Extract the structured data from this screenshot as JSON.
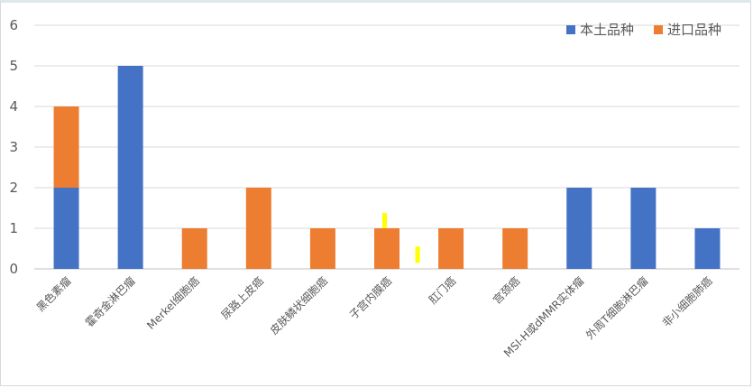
{
  "chart_data": {
    "type": "bar",
    "stacked": true,
    "categories": [
      "黑色素瘤",
      "霍奇金淋巴瘤",
      "Merkel细胞癌",
      "尿路上皮癌",
      "皮肤鳞状细胞癌",
      "子宫内膜癌",
      "肛门癌",
      "宫颈癌",
      "MSI-H或dMMR实体瘤",
      "外周T细胞淋巴瘤",
      "非小细胞肺癌"
    ],
    "series": [
      {
        "name": "本土品种",
        "color": "#4472c4",
        "values": [
          2,
          5,
          0,
          0,
          0,
          0,
          0,
          0,
          2,
          2,
          1
        ]
      },
      {
        "name": "进口品种",
        "color": "#ed7d31",
        "values": [
          2,
          0,
          1,
          2,
          1,
          1,
          1,
          1,
          0,
          0,
          0
        ]
      }
    ],
    "ylim": [
      0,
      6
    ],
    "yticks": [
      0,
      1,
      2,
      3,
      4,
      5,
      6
    ],
    "grid": true,
    "legend_position": "top-right",
    "annotation_color": "#ffff00"
  }
}
